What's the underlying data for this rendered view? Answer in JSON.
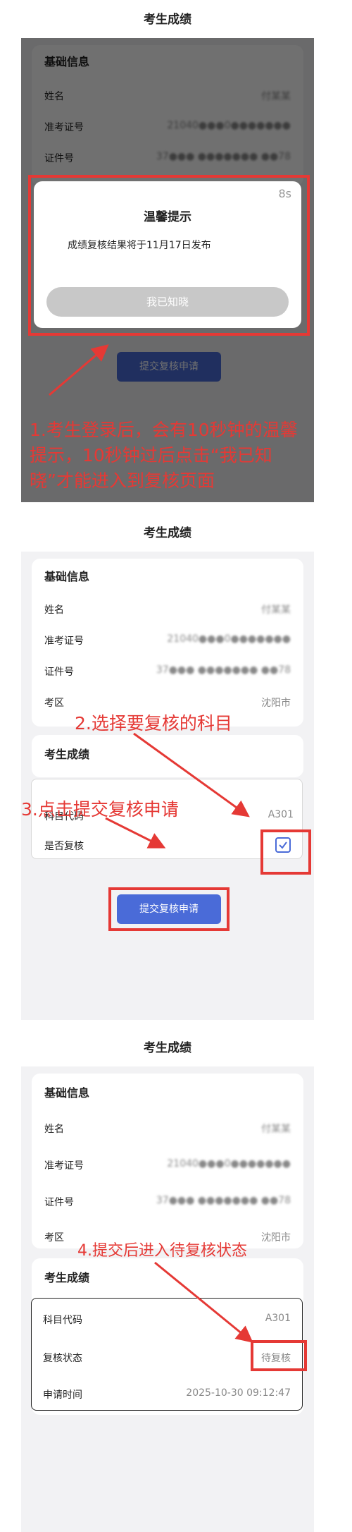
{
  "page_title": "考生成绩",
  "basic_section_title": "基础信息",
  "score_section_title": "考生成绩",
  "labels": {
    "name": "姓名",
    "ticket": "准考证号",
    "id": "证件号",
    "area": "考区",
    "subject_code": "科目代码",
    "whether_review": "是否复核",
    "review_status": "复核状态",
    "apply_time": "申请时间"
  },
  "values": {
    "name_masked": "付某某",
    "ticket_masked": "21040●●●0●●●●●●●",
    "id_masked": "37●●● ●●●●●●● ●●78",
    "area": "沈阳市",
    "subject_code": "A301",
    "review_status": "待复核",
    "apply_time": "2025-10-30 09:12:47"
  },
  "modal": {
    "countdown": "8s",
    "title": "温馨提示",
    "body": "成绩复核结果将于11月17日发布",
    "button": "我已知晓"
  },
  "submit_button": "提交复核申请",
  "annotations": {
    "step1": "1.考生登录后，会有10秒钟的温馨提示，10秒钟过后点击“我已知晓”才能进入到复核页面",
    "step2": "2.选择要复核的科目",
    "step3": "3.点击提交复核申请",
    "step4": "4.提交后进入待复核状态"
  },
  "colors": {
    "annotation_red": "#e53935",
    "primary_blue": "#4a6bd8"
  }
}
